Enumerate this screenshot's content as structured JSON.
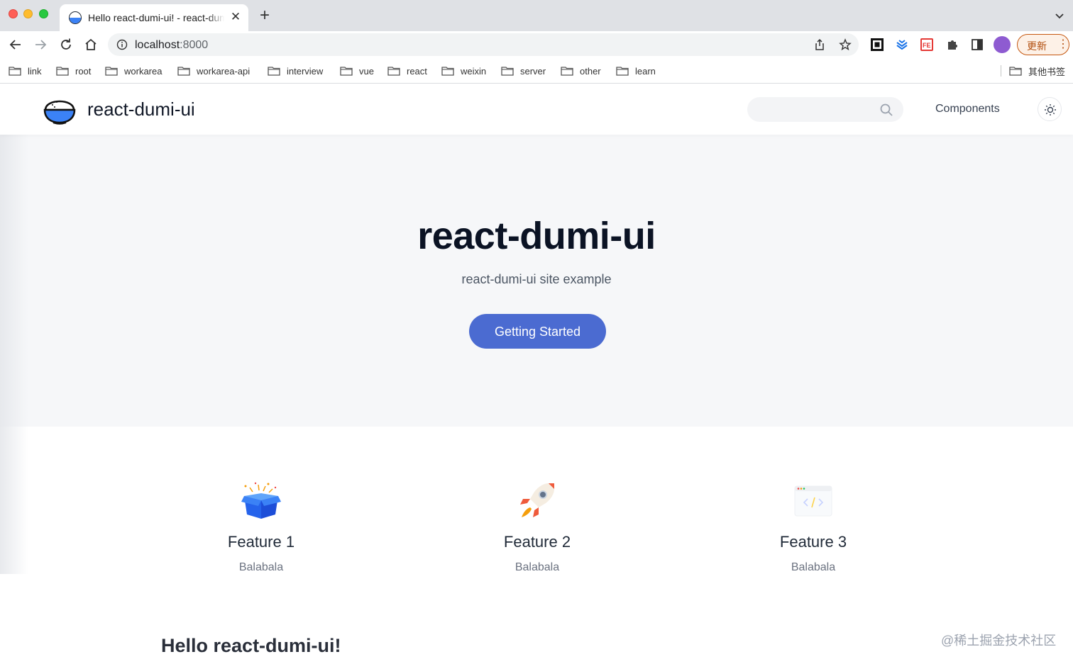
{
  "browser": {
    "tab": {
      "title": "Hello react-dumi-ui! - react-dumi-ui"
    },
    "address": {
      "host": "localhost",
      "port": ":8000"
    },
    "update_button": "更新",
    "bookmarks": [
      {
        "label": "link"
      },
      {
        "label": "root"
      },
      {
        "label": "workarea"
      },
      {
        "label": "workarea-api"
      },
      {
        "label": "interview"
      },
      {
        "label": "vue"
      },
      {
        "label": "react"
      },
      {
        "label": "weixin"
      },
      {
        "label": "server"
      },
      {
        "label": "other"
      },
      {
        "label": "learn"
      }
    ],
    "other_bookmarks": "其他书签"
  },
  "site": {
    "name": "react-dumi-ui",
    "nav": {
      "components": "Components"
    },
    "search": {
      "placeholder": ""
    }
  },
  "hero": {
    "title": "react-dumi-ui",
    "description": "react-dumi-ui site example",
    "cta": "Getting Started"
  },
  "features": [
    {
      "icon": "gift-box-icon",
      "title": "Feature 1",
      "description": "Balabala"
    },
    {
      "icon": "rocket-icon",
      "title": "Feature 2",
      "description": "Balabala"
    },
    {
      "icon": "code-window-icon",
      "title": "Feature 3",
      "description": "Balabala"
    }
  ],
  "content": {
    "heading": "Hello react-dumi-ui!"
  },
  "watermark": "@稀土掘金技术社区",
  "colors": {
    "primary": "#4b6bd1",
    "hero_bg": "#f6f7f9",
    "logo_blue": "#3b82f6"
  }
}
